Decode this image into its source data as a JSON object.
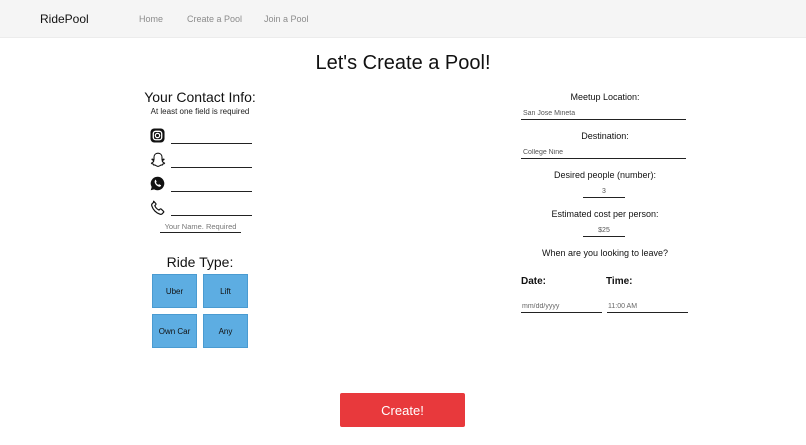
{
  "navbar": {
    "brand": "RidePool",
    "links": [
      "Home",
      "Create a Pool",
      "Join a Pool"
    ]
  },
  "page_title": "Let's Create a Pool!",
  "contact": {
    "title": "Your Contact Info:",
    "subtitle": "At least one field is required",
    "fields": [
      {
        "icon": "instagram-icon",
        "value": ""
      },
      {
        "icon": "snapchat-icon",
        "value": ""
      },
      {
        "icon": "whatsapp-icon",
        "value": ""
      },
      {
        "icon": "phone-icon",
        "value": ""
      }
    ],
    "name_placeholder": "Your Name. Required"
  },
  "ride_type": {
    "title": "Ride Type:",
    "options": [
      "Uber",
      "Lift",
      "Own Car",
      "Any"
    ],
    "button_color": "#5dade2"
  },
  "meetup": {
    "label": "Meetup Location:",
    "placeholder": "San Jose Mineta"
  },
  "destination": {
    "label": "Destination:",
    "placeholder": "College Nine"
  },
  "people": {
    "label": "Desired people (number):",
    "placeholder": "3"
  },
  "cost": {
    "label": "Estimated cost per person:",
    "placeholder": "$25"
  },
  "leave": {
    "question": "When are you looking to leave?",
    "date_label": "Date:",
    "date_placeholder": "mm/dd/yyyy",
    "time_label": "Time:",
    "time_placeholder": "11:00 AM"
  },
  "create_button": {
    "label": "Create!",
    "color": "#e8393c"
  }
}
